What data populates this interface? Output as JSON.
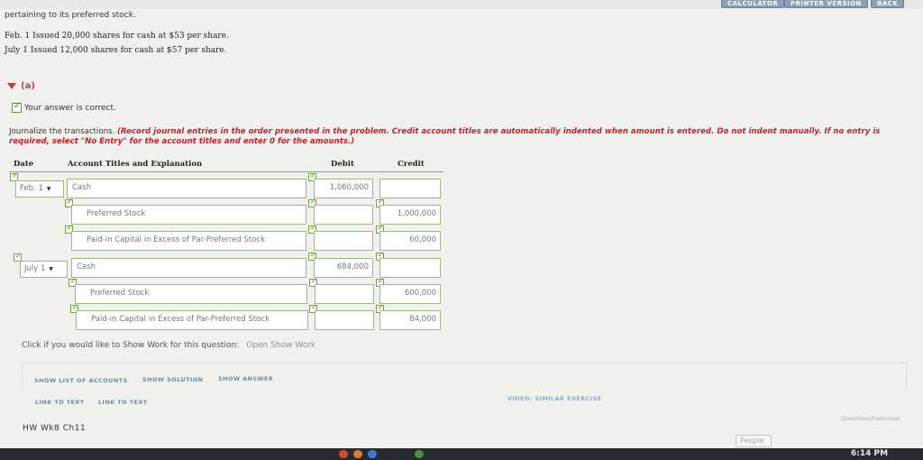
{
  "topbar": {
    "calculator": "CALCULATOR",
    "printer_version": "PRINTER VERSION",
    "back": "BACK"
  },
  "intro": "pertaining to its preferred stock.",
  "transactions": [
    "Feb. 1  Issued 20,000 shares for cash at $53 per share.",
    "July 1  Issued 12,000 shares for cash at $57 per share."
  ],
  "part_label": "(a)",
  "status": "Your answer is correct.",
  "instructions": {
    "lead": "Journalize the transactions. ",
    "note": "(Record journal entries in the order presented in the problem. Credit account titles are automatically indented when amount is entered. Do not indent manually. If no entry is required, select \"No Entry\" for the account titles and enter 0 for the amounts.)"
  },
  "table": {
    "headers": {
      "date": "Date",
      "account": "Account Titles and Explanation",
      "debit": "Debit",
      "credit": "Credit"
    },
    "rows": [
      {
        "date": "Feb. 1",
        "account": "Cash",
        "debit": "1,060,000",
        "credit": ""
      },
      {
        "date": "",
        "account": "Preferred Stock",
        "debit": "",
        "credit": "1,000,000"
      },
      {
        "date": "",
        "account": "Paid-in Capital in Excess of Par-Preferred Stock",
        "debit": "",
        "credit": "60,000"
      },
      {
        "date": "July 1",
        "account": "Cash",
        "debit": "684,000",
        "credit": ""
      },
      {
        "date": "",
        "account": "Preferred Stock",
        "debit": "",
        "credit": "600,000"
      },
      {
        "date": "",
        "account": "Paid-in Capital in Excess of Par-Preferred Stock",
        "debit": "",
        "credit": "84,000"
      }
    ]
  },
  "show_work": {
    "prompt": "Click if you would like to Show Work for this question:",
    "link": "Open Show Work"
  },
  "buttons": {
    "show_list": "SHOW LIST OF ACCOUNTS",
    "show_solution": "SHOW SOLUTION",
    "show_answer": "SHOW ANSWER",
    "link_text_1": "LINK TO TEXT",
    "link_text_2": "LINK TO TEXT",
    "video": "VIDEO: SIMILAR EXERCISE"
  },
  "footer": {
    "assignment": "HW Wk8 Ch11",
    "questions_link": "Questions/Exercises",
    "people": "People"
  },
  "taskbar": {
    "time": "6:14 PM"
  },
  "colors": {
    "accent_red": "#c8202c",
    "button_blue": "#8d9fb4",
    "input_border": "#9fb58a"
  }
}
